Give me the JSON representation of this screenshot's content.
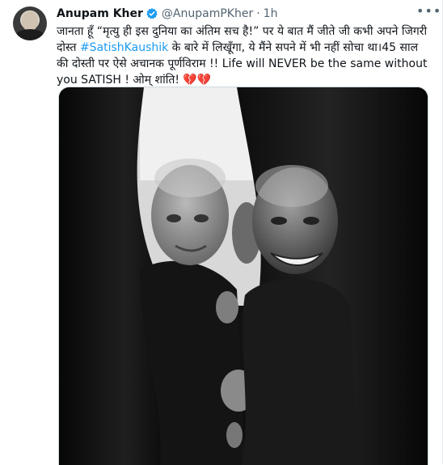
{
  "tweet": {
    "author": {
      "name": "Anupam Kher",
      "handle": "@AnupamPKher",
      "separator": "·",
      "time": "1h",
      "verified_icon": "verified-badge-icon",
      "avatar_icon": "profile-avatar"
    },
    "text": {
      "part1": "जानता हूँ “मृत्यु ही इस दुनिया का अंतिम सच है!” पर ये बात मैं जीते जी कभी अपने जिगरी दोस्त ",
      "hashtag": "#SatishKaushik",
      "part2": " के बारे में लिखूँगा, ये मैंने सपने में भी नहीं सोचा था।45 साल की दोस्ती पर ऐसे अचानक पूर्णविराम !! Life will NEVER be the same without you SATISH ! ओम् शांति! ",
      "hearts": "💔💔"
    },
    "more_icon": "more-options-icon",
    "image_icon": "tweet-photo"
  },
  "colors": {
    "accent": "#1d9bf0",
    "text": "#0f1419",
    "secondary": "#536471"
  }
}
